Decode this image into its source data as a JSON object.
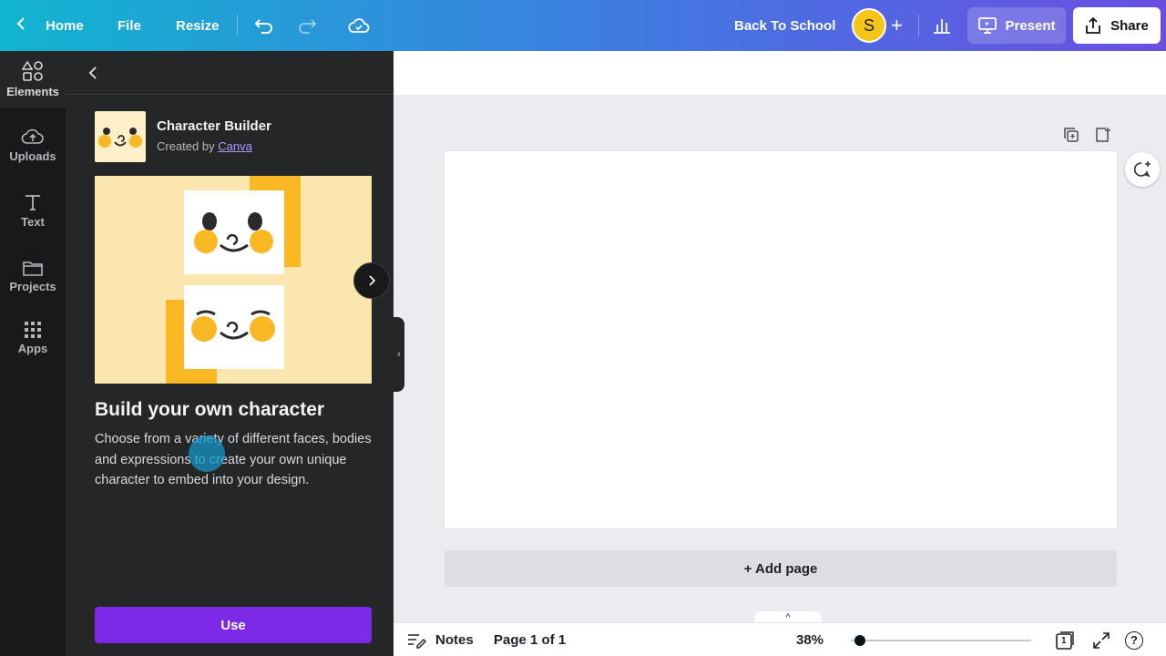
{
  "topbar": {
    "home": "Home",
    "file": "File",
    "resize": "Resize",
    "design_title": "Back To School",
    "avatar_initial": "S",
    "present": "Present",
    "share": "Share",
    "gradient_start": "#11b5cf",
    "gradient_end": "#6a4fdf"
  },
  "rail": {
    "items": [
      {
        "label": "Elements",
        "icon": "shapes-icon"
      },
      {
        "label": "Uploads",
        "icon": "cloud-upload-icon"
      },
      {
        "label": "Text",
        "icon": "text-t-icon"
      },
      {
        "label": "Projects",
        "icon": "folder-icon"
      },
      {
        "label": "Apps",
        "icon": "grid-icon"
      }
    ]
  },
  "panel": {
    "app_name": "Character Builder",
    "created_by": "Created by",
    "author": "Canva",
    "title": "Build your own character",
    "description": "Choose from a variety of different faces, bodies and expressions to create your own unique character to embed into your design.",
    "use_button": "Use",
    "accent": "#7d2ae8"
  },
  "canvas": {
    "add_page": "+ Add page"
  },
  "bottombar": {
    "notes": "Notes",
    "page_indicator": "Page 1 of 1",
    "zoom": "38%",
    "page_count": "1",
    "help": "?"
  }
}
